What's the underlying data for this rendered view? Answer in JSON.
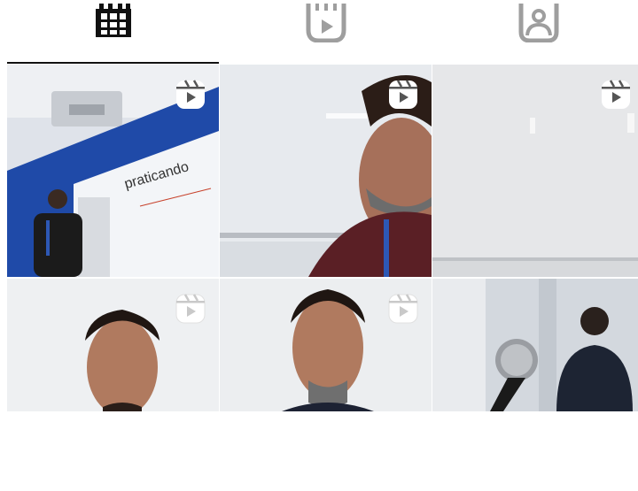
{
  "profile_tabs": [
    {
      "name": "posts-grid",
      "icon": "grid-icon",
      "selected": true
    },
    {
      "name": "reels",
      "icon": "reels-icon",
      "selected": false
    },
    {
      "name": "tagged",
      "icon": "tagged-person-icon",
      "selected": false
    }
  ],
  "tiles": [
    {
      "type": "reel",
      "icon": "reels-icon",
      "slide_word": "praticando"
    },
    {
      "type": "reel",
      "icon": "reels-icon"
    },
    {
      "type": "reel",
      "icon": "reels-icon"
    },
    {
      "type": "reel",
      "icon": "reels-icon"
    },
    {
      "type": "reel",
      "icon": "reels-icon"
    },
    {
      "type": "reel",
      "icon": "reels-icon"
    }
  ],
  "colors": {
    "tab_active": "#111111",
    "tab_inactive": "#9e9e9e",
    "indicator": "#111111"
  }
}
